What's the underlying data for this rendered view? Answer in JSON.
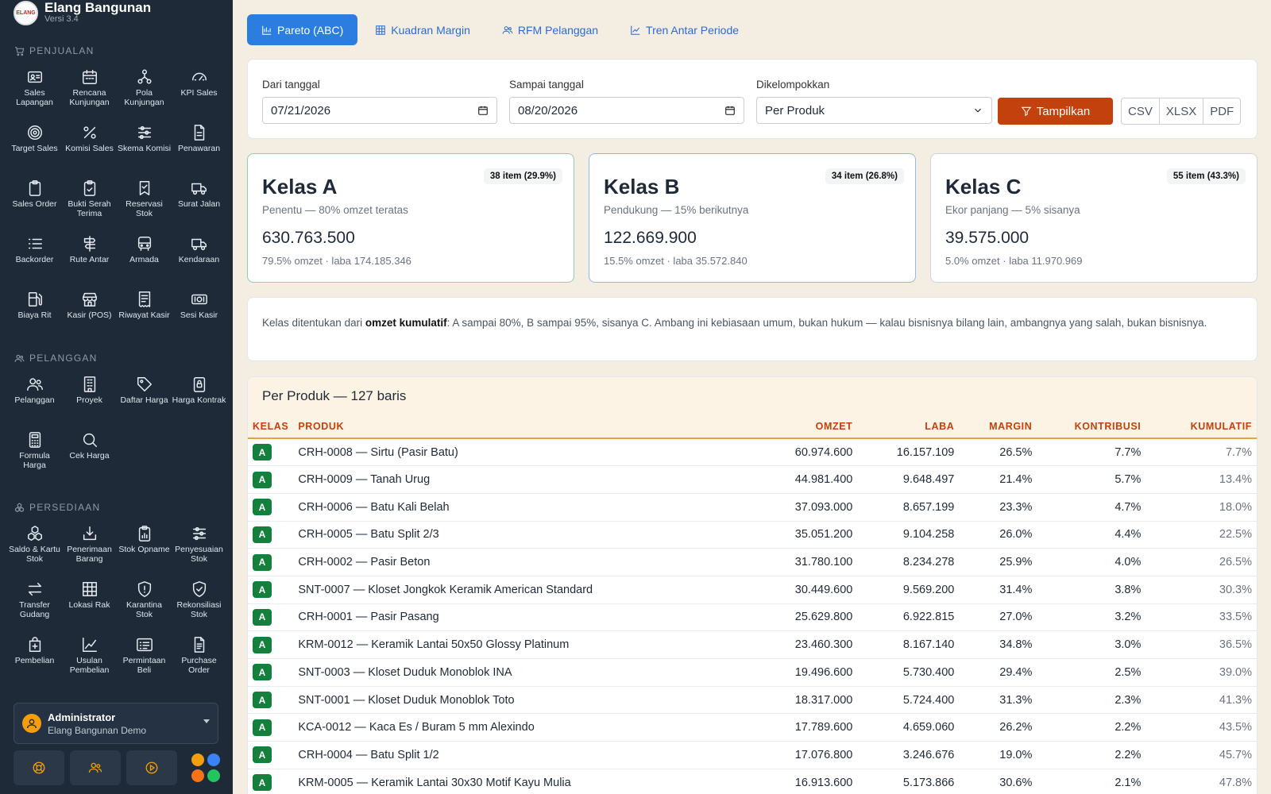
{
  "brand": {
    "name": "Elang Bangunan",
    "version": "Versi 3.4",
    "logo_text": "ELANG"
  },
  "sections": [
    {
      "title": "PENJUALAN",
      "icon": "cart-icon",
      "items": [
        {
          "label": "Sales Lapangan",
          "icon": "id-card-icon"
        },
        {
          "label": "Rencana Kunjungan",
          "icon": "calendar-icon"
        },
        {
          "label": "Pola Kunjungan",
          "icon": "nodes-icon"
        },
        {
          "label": "KPI Sales",
          "icon": "gauge-icon"
        },
        {
          "label": "Target Sales",
          "icon": "target-icon"
        },
        {
          "label": "Komisi Sales",
          "icon": "percent-icon"
        },
        {
          "label": "Skema Komisi",
          "icon": "sliders-icon"
        },
        {
          "label": "Penawaran",
          "icon": "document-icon"
        },
        {
          "label": "Sales Order",
          "icon": "clipboard-icon"
        },
        {
          "label": "Bukti Serah Terima",
          "icon": "clipboard-check-icon"
        },
        {
          "label": "Reservasi Stok",
          "icon": "bookmark-icon"
        },
        {
          "label": "Surat Jalan",
          "icon": "truck-icon"
        },
        {
          "label": "Backorder",
          "icon": "list-icon"
        },
        {
          "label": "Rute Antar",
          "icon": "signpost-icon"
        },
        {
          "label": "Armada",
          "icon": "bus-icon"
        },
        {
          "label": "Kendaraan",
          "icon": "truck-icon"
        },
        {
          "label": "Biaya Rit",
          "icon": "fuel-icon"
        },
        {
          "label": "Kasir (POS)",
          "icon": "shop-icon"
        },
        {
          "label": "Riwayat Kasir",
          "icon": "receipt-icon"
        },
        {
          "label": "Sesi Kasir",
          "icon": "cash-icon"
        }
      ]
    },
    {
      "title": "PELANGGAN",
      "icon": "people-icon",
      "items": [
        {
          "label": "Pelanggan",
          "icon": "people-icon"
        },
        {
          "label": "Proyek",
          "icon": "building-icon"
        },
        {
          "label": "Daftar Harga",
          "icon": "tag-icon"
        },
        {
          "label": "Harga Kontrak",
          "icon": "lock-icon"
        },
        {
          "label": "Formula Harga",
          "icon": "calculator-icon"
        },
        {
          "label": "Cek Harga",
          "icon": "search-icon"
        }
      ]
    },
    {
      "title": "PERSEDIAAN",
      "icon": "boxes-icon",
      "items": [
        {
          "label": "Saldo & Kartu Stok",
          "icon": "boxes-icon"
        },
        {
          "label": "Penerimaan Barang",
          "icon": "inbox-download-icon"
        },
        {
          "label": "Stok Opname",
          "icon": "clipboard-chart-icon"
        },
        {
          "label": "Penyesuaian Stok",
          "icon": "sliders-icon"
        },
        {
          "label": "Transfer Gudang",
          "icon": "arrows-icon"
        },
        {
          "label": "Lokasi Rak",
          "icon": "grid-icon"
        },
        {
          "label": "Karantina Stok",
          "icon": "shield-icon"
        },
        {
          "label": "Rekonsiliasi Stok",
          "icon": "shield-check-icon"
        },
        {
          "label": "Pembelian",
          "icon": "bag-plus-icon"
        },
        {
          "label": "Usulan Pembelian",
          "icon": "chart-line-icon"
        },
        {
          "label": "Permintaan Beli",
          "icon": "card-list-icon"
        },
        {
          "label": "Purchase Order",
          "icon": "file-text-icon"
        }
      ]
    }
  ],
  "user": {
    "name": "Administrator",
    "org": "Elang Bangunan Demo"
  },
  "bottom_buttons": [
    "lifebuoy-icon",
    "people-icon",
    "play-circle-icon"
  ],
  "theme_dots": [
    "#f59e0b",
    "#3b82f6",
    "#f97316",
    "#22c55e"
  ],
  "tabs": [
    {
      "label": "Pareto (ABC)",
      "icon": "bar-chart-icon",
      "active": true
    },
    {
      "label": "Kuadran Margin",
      "icon": "grid-icon",
      "active": false
    },
    {
      "label": "RFM Pelanggan",
      "icon": "people-icon",
      "active": false
    },
    {
      "label": "Tren Antar Periode",
      "icon": "trend-icon",
      "active": false
    }
  ],
  "filters": {
    "from_label": "Dari tanggal",
    "from_value": "07/21/2026",
    "to_label": "Sampai tanggal",
    "to_value": "08/20/2026",
    "group_label": "Dikelompokkan",
    "group_value": "Per Produk",
    "show_button": "Tampilkan",
    "exports": [
      "CSV",
      "XLSX",
      "PDF"
    ]
  },
  "classes": [
    {
      "title": "Kelas A",
      "badge": "38 item (29.9%)",
      "sub": "Penentu — 80% omzet teratas",
      "value": "630.763.500",
      "meta": "79.5% omzet · laba 174.185.346",
      "border": "#8fd0ab"
    },
    {
      "title": "Kelas B",
      "badge": "34 item (26.8%)",
      "sub": "Pendukung — 15% berikutnya",
      "value": "122.669.900",
      "meta": "15.5% omzet · laba 35.572.840",
      "border": "#93b9ea"
    },
    {
      "title": "Kelas C",
      "badge": "55 item (43.3%)",
      "sub": "Ekor panjang — 5% sisanya",
      "value": "39.575.000",
      "meta": "5.0% omzet · laba 11.970.969",
      "border": "#cfd4da"
    }
  ],
  "note": {
    "prefix": "Kelas ditentukan dari ",
    "bold": "omzet kumulatif",
    "suffix": ": A sampai 80%, B sampai 95%, sisanya C. Ambang ini kebiasaan umum, bukan hukum — kalau bisnisnya bilang lain, ambangnya yang salah, bukan bisnisnya."
  },
  "table": {
    "title": "Per Produk — 127 baris",
    "headers": [
      "KELAS",
      "PRODUK",
      "OMZET",
      "LABA",
      "MARGIN",
      "KONTRIBUSI",
      "KUMULATIF"
    ],
    "rows": [
      [
        "A",
        "CRH-0008 — Sirtu (Pasir Batu)",
        "60.974.600",
        "16.157.109",
        "26.5%",
        "7.7%",
        "7.7%"
      ],
      [
        "A",
        "CRH-0009 — Tanah Urug",
        "44.981.400",
        "9.648.497",
        "21.4%",
        "5.7%",
        "13.4%"
      ],
      [
        "A",
        "CRH-0006 — Batu Kali Belah",
        "37.093.000",
        "8.657.199",
        "23.3%",
        "4.7%",
        "18.0%"
      ],
      [
        "A",
        "CRH-0005 — Batu Split 2/3",
        "35.051.200",
        "9.104.258",
        "26.0%",
        "4.4%",
        "22.5%"
      ],
      [
        "A",
        "CRH-0002 — Pasir Beton",
        "31.780.100",
        "8.234.278",
        "25.9%",
        "4.0%",
        "26.5%"
      ],
      [
        "A",
        "SNT-0007 — Kloset Jongkok Keramik American Standard",
        "30.449.600",
        "9.569.200",
        "31.4%",
        "3.8%",
        "30.3%"
      ],
      [
        "A",
        "CRH-0001 — Pasir Pasang",
        "25.629.800",
        "6.922.815",
        "27.0%",
        "3.2%",
        "33.5%"
      ],
      [
        "A",
        "KRM-0012 — Keramik Lantai 50x50 Glossy Platinum",
        "23.460.300",
        "8.167.140",
        "34.8%",
        "3.0%",
        "36.5%"
      ],
      [
        "A",
        "SNT-0003 — Kloset Duduk Monoblok INA",
        "19.496.600",
        "5.730.400",
        "29.4%",
        "2.5%",
        "39.0%"
      ],
      [
        "A",
        "SNT-0001 — Kloset Duduk Monoblok Toto",
        "18.317.000",
        "5.724.400",
        "31.3%",
        "2.3%",
        "41.3%"
      ],
      [
        "A",
        "KCA-0012 — Kaca Es / Buram 5 mm Alexindo",
        "17.789.600",
        "4.659.060",
        "26.2%",
        "2.2%",
        "43.5%"
      ],
      [
        "A",
        "CRH-0004 — Batu Split 1/2",
        "17.076.800",
        "3.246.676",
        "19.0%",
        "2.2%",
        "45.7%"
      ],
      [
        "A",
        "KRM-0005 — Keramik Lantai 30x30 Motif Kayu Mulia",
        "16.913.600",
        "5.173.866",
        "30.6%",
        "2.1%",
        "47.8%"
      ]
    ]
  }
}
